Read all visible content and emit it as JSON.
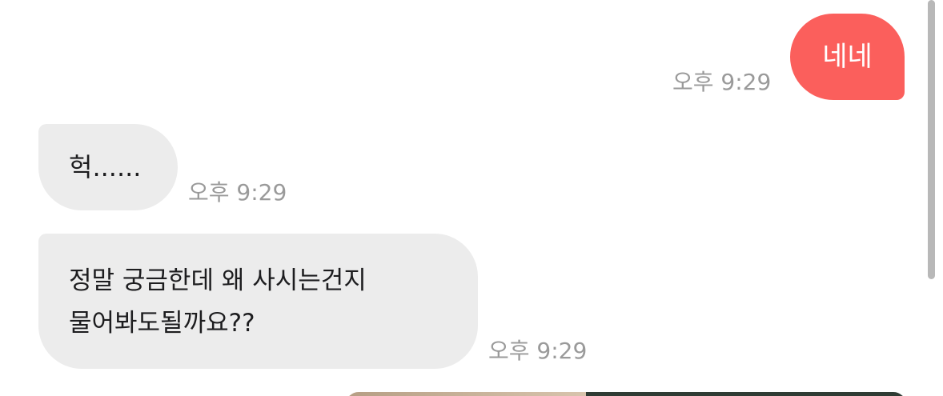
{
  "messages": [
    {
      "direction": "outgoing",
      "text": "네네",
      "time": "오후 9:29"
    },
    {
      "direction": "incoming",
      "text": "헉......",
      "time": "오후 9:29"
    },
    {
      "direction": "incoming",
      "lines": [
        "정말 궁금한데 왜 사시는건지",
        "물어봐도될까요??"
      ],
      "time": "오후 9:29"
    }
  ],
  "colors": {
    "outgoing_bubble": "#fb5f5c",
    "incoming_bubble": "#ececec",
    "timestamp": "#9a9a9a"
  }
}
